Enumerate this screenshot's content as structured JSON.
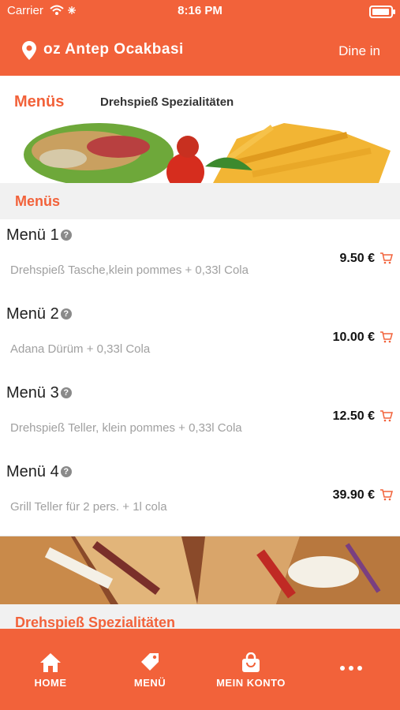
{
  "status": {
    "carrier": "Carrier",
    "time": "8:16 PM"
  },
  "header": {
    "restaurant": "oz Antep Ocakbasi",
    "mode": "Dine in"
  },
  "categories": {
    "active": "Menüs",
    "other": "Drehspieß Spezialitäten"
  },
  "section1": {
    "title": "Menüs"
  },
  "items": [
    {
      "name": "Menü 1",
      "desc": "Drehspieß Tasche,klein pommes + 0,33l Cola",
      "price": "9.50 €"
    },
    {
      "name": "Menü 2",
      "desc": "Adana Dürüm + 0,33l Cola",
      "price": "10.00 €"
    },
    {
      "name": "Menü 3",
      "desc": "Drehspieß Teller, klein pommes + 0,33l Cola",
      "price": "12.50 €"
    },
    {
      "name": "Menü 4",
      "desc": "Grill Teller für 2 pers. + 1l cola",
      "price": "39.90 €"
    }
  ],
  "section2": {
    "title": "Drehspieß Spezialitäten"
  },
  "nav": {
    "home": "HOME",
    "menu": "MENÜ",
    "account": "MEIN KONTO"
  },
  "colors": {
    "accent": "#f2623a"
  }
}
